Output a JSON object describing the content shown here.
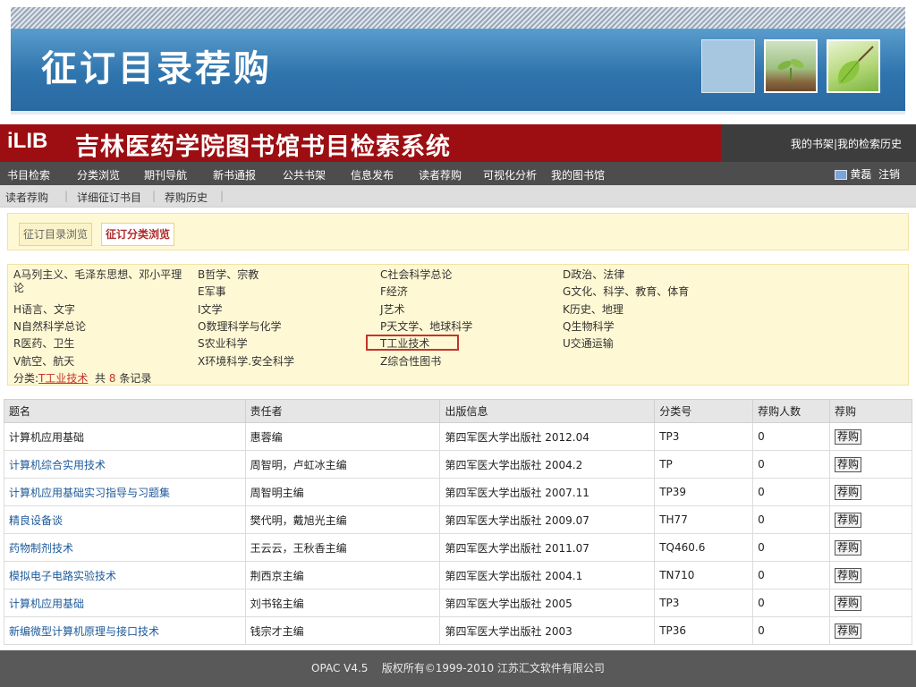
{
  "slide": {
    "title": "征订目录荐购"
  },
  "header": {
    "logo": "iLIB",
    "title": "吉林医药学院图书馆书目检索系统",
    "my_shelf": "我的书架",
    "separator": "|",
    "my_history": "我的检索历史"
  },
  "menu": {
    "items": [
      "书目检索",
      "分类浏览",
      "期刊导航",
      "新书通报",
      "公共书架",
      "信息发布",
      "读者荐购",
      "可视化分析",
      "我的图书馆"
    ],
    "user": "黄磊",
    "logout": "注销"
  },
  "submenu": {
    "items": [
      "读者荐购",
      "详细征订书目",
      "荐购历史"
    ],
    "separator": "|"
  },
  "tabs": [
    "征订目录浏览",
    "征订分类浏览"
  ],
  "categories": {
    "col1": [
      "A马列主义、毛泽东思想、邓小平理论",
      "H语言、文字",
      "N自然科学总论",
      "R医药、卫生",
      "V航空、航天"
    ],
    "col2": [
      "B哲学、宗教",
      "E军事",
      "I文学",
      "O数理科学与化学",
      "S农业科学",
      "X环境科学.安全科学"
    ],
    "col3": [
      "C社会科学总论",
      "F经济",
      "J艺术",
      "P天文学、地球科学",
      "T工业技术",
      "Z综合性图书"
    ],
    "col4": [
      "D政治、法律",
      "G文化、科学、教育、体育",
      "K历史、地理",
      "Q生物科学",
      "U交通运输"
    ]
  },
  "status": {
    "prefix": "分类:",
    "category": "T工业技术",
    "count_prefix": "共",
    "count": "8",
    "count_suffix": "条记录"
  },
  "table": {
    "headers": [
      "题名",
      "责任者",
      "出版信息",
      "分类号",
      "荐购人数",
      "荐购"
    ],
    "rows": [
      {
        "title": "计算机应用基础",
        "author": "惠蓉编",
        "pub": "第四军医大学出版社 2012.04",
        "cls": "TP3",
        "count": "0",
        "btn": "荐购"
      },
      {
        "title": "计算机综合实用技术",
        "author": "周智明，卢虹冰主编",
        "pub": "第四军医大学出版社 2004.2",
        "cls": "TP",
        "count": "0",
        "btn": "荐购"
      },
      {
        "title": "计算机应用基础实习指导与习题集",
        "author": "周智明主编",
        "pub": "第四军医大学出版社 2007.11",
        "cls": "TP39",
        "count": "0",
        "btn": "荐购"
      },
      {
        "title": "精良设备谈",
        "author": "樊代明，戴旭光主编",
        "pub": "第四军医大学出版社 2009.07",
        "cls": "TH77",
        "count": "0",
        "btn": "荐购"
      },
      {
        "title": "药物制剂技术",
        "author": "王云云，王秋香主编",
        "pub": "第四军医大学出版社 2011.07",
        "cls": "TQ460.6",
        "count": "0",
        "btn": "荐购"
      },
      {
        "title": "模拟电子电路实验技术",
        "author": "荆西京主编",
        "pub": "第四军医大学出版社 2004.1",
        "cls": "TN710",
        "count": "0",
        "btn": "荐购"
      },
      {
        "title": "计算机应用基础",
        "author": "刘书铭主编",
        "pub": "第四军医大学出版社 2005",
        "cls": "TP3",
        "count": "0",
        "btn": "荐购"
      },
      {
        "title": "新编微型计算机原理与接口技术",
        "author": "钱宗才主编",
        "pub": "第四军医大学出版社 2003",
        "cls": "TP36",
        "count": "0",
        "btn": "荐购"
      }
    ]
  },
  "footer": {
    "text": "OPAC V4.5    版权所有©1999-2010 江苏汇文软件有限公司"
  },
  "colors": {
    "brand_red": "#9c0e12",
    "menu_dark": "#4d4d4d",
    "slide_blue": "#2f74ad",
    "highlight": "#c4342d",
    "link_blue": "#1d5a9a"
  }
}
